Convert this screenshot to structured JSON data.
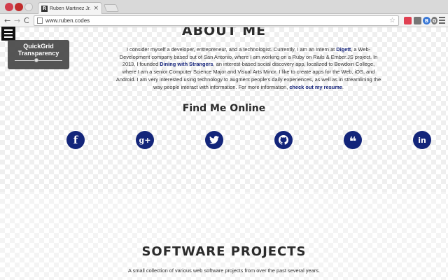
{
  "browser": {
    "tab_title": "Ruben Martinez Jr.",
    "tab_favicon": "R",
    "tab_close": "×",
    "url": "www.ruben.codes",
    "nav": {
      "back": "←",
      "forward": "→",
      "reload": "C"
    },
    "extensions": [
      {
        "name": "pocket",
        "color": "#e04052",
        "glyph": ""
      },
      {
        "name": "mail",
        "color": "#777777",
        "glyph": ""
      },
      {
        "name": "b-extension",
        "color": "#3a78d6",
        "glyph": "B"
      },
      {
        "name": "g-extension",
        "color": "#777777",
        "glyph": "G"
      },
      {
        "name": "s-extension",
        "color": "#1e6ad8",
        "glyph": "S"
      }
    ]
  },
  "quickgrid": {
    "label": "QuickGrid Transparency",
    "slider_value": 0.45
  },
  "about": {
    "heading": "ABOUT ME",
    "bio_1": "I consider myself a developer, entrepreneur, and a technologist. Currently, I am an Intern at ",
    "link_digett": "Digett",
    "bio_2": ", a Web-Development company based out of San Antonio, where I am working on a Ruby on Rails & Ember.JS project. In 2013, I founded ",
    "link_dining": "Dining with Strangers",
    "bio_3": ", an interest-based social discovery app, localized to Bowdoin College, where I am a senior Computer Science Major and Visual Arts Minor. I like to create apps for the Web, iOS, and Android. I am very interested using technology to augment people's daily experiences, as well as in streamlining the way people interact with information. For more information, ",
    "link_resume": "check out my resume",
    "bio_4": "."
  },
  "find_me": {
    "heading": "Find Me Online",
    "icons": [
      {
        "name": "facebook",
        "glyph": "f"
      },
      {
        "name": "google-plus",
        "glyph": "g+"
      },
      {
        "name": "twitter",
        "glyph": "🐦"
      },
      {
        "name": "github",
        "glyph": ""
      },
      {
        "name": "quote",
        "glyph": "❝"
      },
      {
        "name": "linkedin",
        "glyph": "in"
      }
    ]
  },
  "software": {
    "heading": "SOFTWARE PROJECTS",
    "subtitle": "A small collection of various web software projects from over the past several years."
  },
  "colors": {
    "accent": "#13257a",
    "link": "#14237a",
    "heading": "#2b2b2b"
  }
}
